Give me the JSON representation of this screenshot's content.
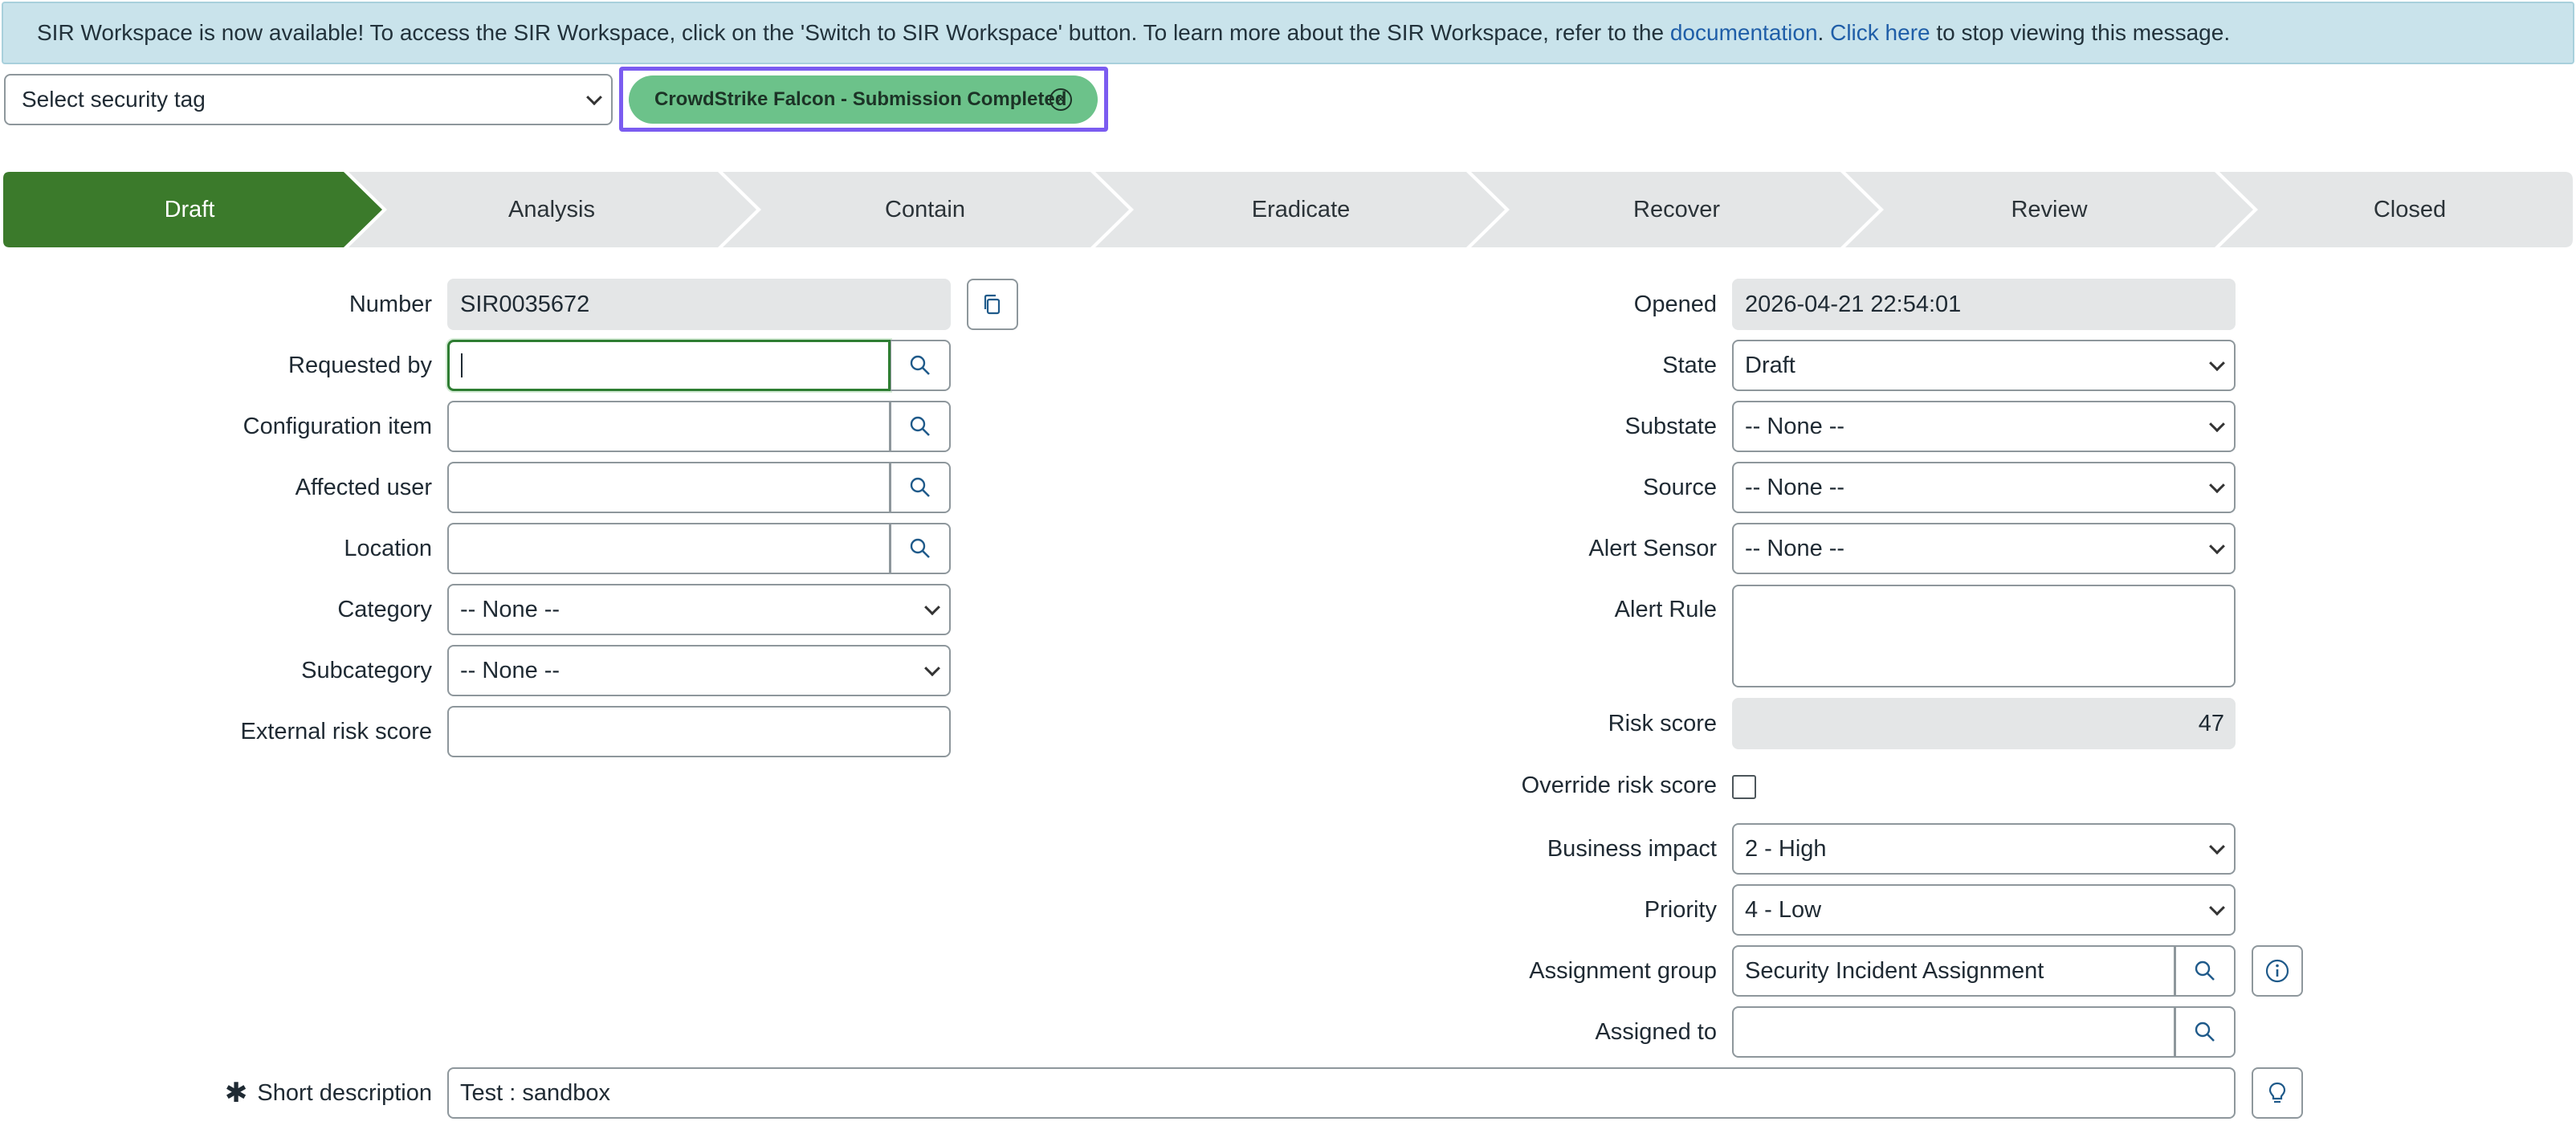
{
  "banner": {
    "text_before": "SIR Workspace is now available! To access the SIR Workspace, click on the 'Switch to SIR Workspace' button. To learn more about the SIR Workspace, refer to the ",
    "doc_link": "documentation",
    "text_mid": ". ",
    "click_here": "Click here",
    "text_after": " to stop viewing this message."
  },
  "security_tag": {
    "placeholder": "Select security tag",
    "tag_label": "CrowdStrike Falcon - Submission Completed"
  },
  "process_flow": {
    "stages": [
      "Draft",
      "Analysis",
      "Contain",
      "Eradicate",
      "Recover",
      "Review",
      "Closed"
    ],
    "active_index": 0,
    "active_color": "#3b7a2b",
    "inactive_color": "#e4e6e7"
  },
  "form": {
    "number": {
      "label": "Number",
      "value": "SIR0035672"
    },
    "requested_by": {
      "label": "Requested by",
      "value": ""
    },
    "configuration_item": {
      "label": "Configuration item",
      "value": ""
    },
    "affected_user": {
      "label": "Affected user",
      "value": ""
    },
    "location": {
      "label": "Location",
      "value": ""
    },
    "category": {
      "label": "Category",
      "value": "-- None --"
    },
    "subcategory": {
      "label": "Subcategory",
      "value": "-- None --"
    },
    "external_risk_score": {
      "label": "External risk score",
      "value": ""
    },
    "opened": {
      "label": "Opened",
      "value": "2026-04-21 22:54:01"
    },
    "state": {
      "label": "State",
      "value": "Draft"
    },
    "substate": {
      "label": "Substate",
      "value": "-- None --"
    },
    "source": {
      "label": "Source",
      "value": "-- None --"
    },
    "alert_sensor": {
      "label": "Alert Sensor",
      "value": "-- None --"
    },
    "alert_rule": {
      "label": "Alert Rule",
      "value": ""
    },
    "risk_score": {
      "label": "Risk score",
      "value": "47"
    },
    "override_risk_score": {
      "label": "Override risk score",
      "checked": false
    },
    "business_impact": {
      "label": "Business impact",
      "value": "2 - High"
    },
    "priority": {
      "label": "Priority",
      "value": "4 - Low"
    },
    "assignment_group": {
      "label": "Assignment group",
      "value": "Security Incident Assignment"
    },
    "assigned_to": {
      "label": "Assigned to",
      "value": ""
    },
    "short_description": {
      "label": "Short description",
      "mandatory_mark": "✱",
      "value": "Test : sandbox"
    }
  },
  "colors": {
    "banner_bg": "#c9e3eb",
    "tag_pill": "#6cc28a",
    "tag_highlight": "#7b5cf0",
    "focus": "#2e7d32",
    "link": "#1f5ea8"
  }
}
